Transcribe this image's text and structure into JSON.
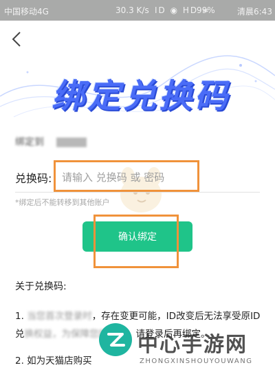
{
  "status_bar": {
    "carrier": "中国移动4G",
    "speed": "30.3 K/s",
    "icons": "ID ◉ HD ≈",
    "battery": "99%",
    "time": "清晨6:43"
  },
  "banner": {
    "title": "绑定兑换码"
  },
  "bound_line": {
    "label": "绑定到"
  },
  "form": {
    "code_label": "兑换码:",
    "code_placeholder": "请输入 兑换码 或 密码",
    "note": "*绑定后不能转移到其他账户"
  },
  "confirm_button": {
    "label": "确认绑定"
  },
  "about": {
    "title": "关于兑换码:",
    "item1_prefix": "1.",
    "item1_blur1": "当您首次登录时",
    "item1_text1": "，存在变更可能，ID改变后无法享受原ID兑",
    "item1_blur2": "换权益，为保障",
    "item1_blur3": "您的权益",
    "item1_text2": "，请登录后再绑定。",
    "item2": "2. 如为天猫店购买"
  },
  "watermark": {
    "cn": "中心手游网",
    "en": "ZHONGXINSHOUYOUWANG"
  },
  "colors": {
    "accent_green": "#1fc489",
    "highlight_orange": "#f0923a",
    "banner_blue": "#4a6cf7"
  }
}
